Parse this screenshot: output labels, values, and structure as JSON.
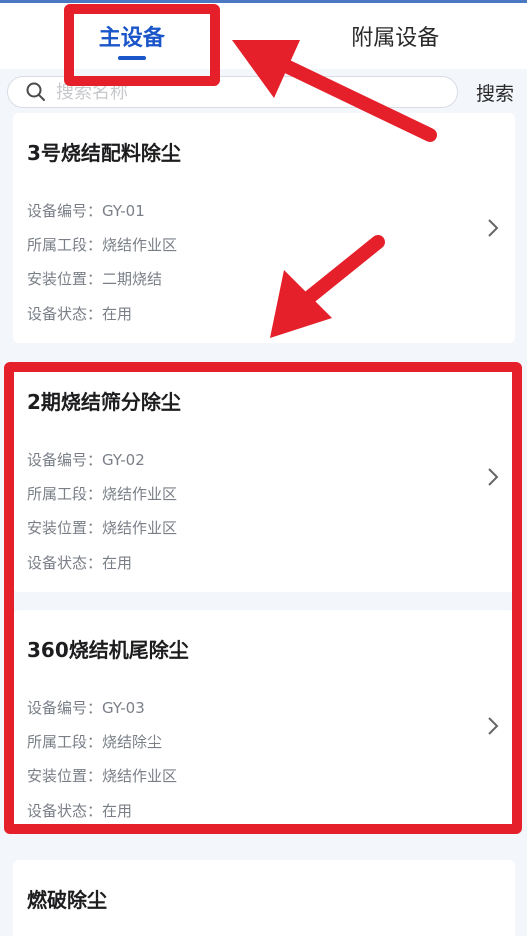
{
  "tabs": [
    {
      "label": "主设备",
      "active": true
    },
    {
      "label": "附属设备",
      "active": false
    }
  ],
  "search": {
    "placeholder": "搜索名称",
    "button_label": "搜索"
  },
  "devices": [
    {
      "name": "3号烧结配料除尘",
      "fields": [
        "设备编号：GY-01",
        "所属工段：烧结作业区",
        "安装位置：二期烧结",
        "设备状态：在用"
      ]
    },
    {
      "name": "2期烧结筛分除尘",
      "fields": [
        "设备编号：GY-02",
        "所属工段：烧结作业区",
        "安装位置：烧结作业区",
        "设备状态：在用"
      ]
    },
    {
      "name": "360烧结机尾除尘",
      "fields": [
        "设备编号：GY-03",
        "所属工段：烧结除尘",
        "安装位置：烧结作业区",
        "设备状态：在用"
      ]
    },
    {
      "name": "燃破除尘",
      "fields": []
    }
  ],
  "colors": {
    "accent": "#1a55c9",
    "annotation": "#e5202a",
    "background": "#f3f6fb"
  },
  "icons": {
    "search": "search-icon",
    "chevron": "chevron-right-icon"
  }
}
